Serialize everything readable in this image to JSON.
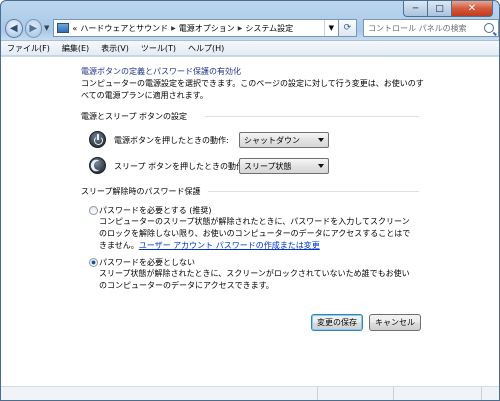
{
  "nav": {
    "back_icon": "back-arrow-icon",
    "forward_icon": "forward-arrow-icon",
    "breadcrumb_prefix": "«",
    "breadcrumbs": [
      "ハードウェアとサウンド",
      "電源オプション",
      "システム設定"
    ],
    "search_placeholder": "コントロール パネルの検索"
  },
  "menu": {
    "items": [
      "ファイル(F)",
      "編集(E)",
      "表示(V)",
      "ツール(T)",
      "ヘルプ(H)"
    ]
  },
  "page": {
    "title": "電源ボタンの定義とパスワード保護の有効化",
    "description": "コンピューターの電源設定を選択できます。このページの設定に対して行う変更は、お使いのすべての電源プランに適用されます。"
  },
  "power_section": {
    "heading": "電源とスリープ ボタンの設定",
    "power_button_label": "電源ボタンを押したときの動作:",
    "power_button_value": "シャットダウン",
    "sleep_button_label": "スリープ ボタンを押したときの動作:",
    "sleep_button_value": "スリープ状態"
  },
  "password_section": {
    "heading": "スリープ解除時のパスワード保護",
    "require_label": "パスワードを必要とする (推奨)",
    "require_desc": "コンピューターのスリープ状態が解除されたときに、パスワードを入力してスクリーンのロックを解除しない限り、お使いのコンピューターのデータにアクセスすることはできません。",
    "require_link": "ユーザー アカウント パスワードの作成または変更",
    "no_require_label": "パスワードを必要としない",
    "no_require_desc": "スリープ状態が解除されたときに、スクリーンがロックされていないため誰でもお使いのコンピューターのデータにアクセスできます。",
    "selected": "no_require"
  },
  "buttons": {
    "save": "変更の保存",
    "cancel": "キャンセル"
  },
  "window": {
    "close_glyph": "✕",
    "minimize_glyph": "─",
    "maximize_glyph": "□"
  }
}
